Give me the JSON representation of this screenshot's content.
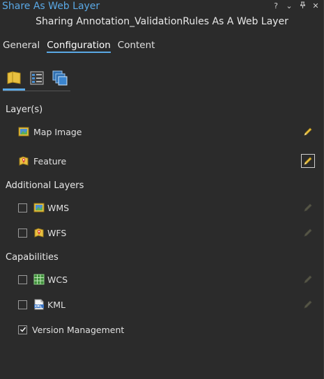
{
  "window": {
    "title": "Share As Web Layer",
    "controls": [
      "?",
      "⌄",
      "⊥",
      "✕"
    ]
  },
  "subtitle": "Sharing Annotation_ValidationRules As A Web Layer",
  "tabs": [
    {
      "label": "General",
      "active": false
    },
    {
      "label": "Configuration",
      "active": true
    },
    {
      "label": "Content",
      "active": false
    }
  ],
  "config_icons": [
    "layers-folder-icon",
    "properties-list-icon",
    "stacked-pages-icon"
  ],
  "sections": {
    "layers": "Layer(s)",
    "additional": "Additional Layers",
    "capabilities": "Capabilities"
  },
  "layers": [
    {
      "label": "Map Image",
      "icon": "map-image-icon",
      "edit_style": "normal"
    },
    {
      "label": "Feature",
      "icon": "feature-icon",
      "edit_style": "boxed"
    }
  ],
  "additional_layers": [
    {
      "label": "WMS",
      "icon": "wms-icon",
      "checked": false
    },
    {
      "label": "WFS",
      "icon": "wfs-icon",
      "checked": false
    }
  ],
  "capabilities": [
    {
      "label": "WCS",
      "icon": "wcs-icon",
      "checked": false
    },
    {
      "label": "KML",
      "icon": "kml-icon",
      "checked": false
    },
    {
      "label": "Version Management",
      "checked": true
    }
  ],
  "colors": {
    "accent": "#5aa9e6",
    "background": "#2b2b2b",
    "pencil": "#e8c040"
  }
}
